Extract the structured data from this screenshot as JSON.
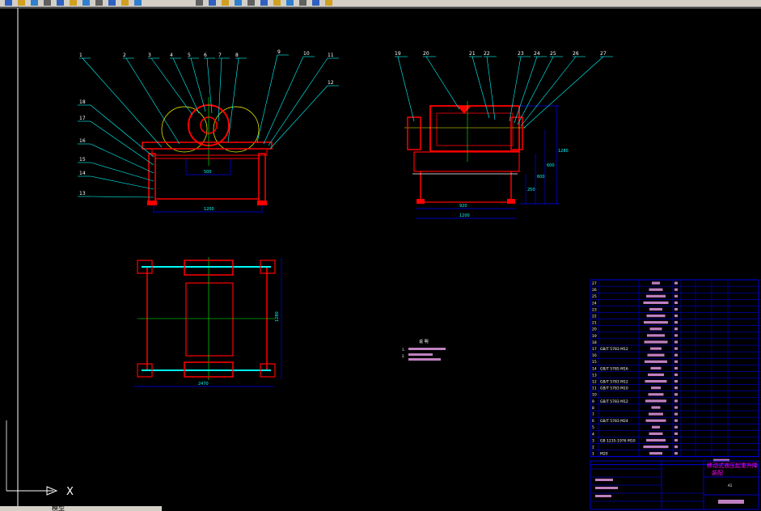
{
  "toolbar": {
    "icons": [
      "new-icon",
      "open-icon",
      "save-icon",
      "print-icon",
      "preview-icon",
      "cut-icon",
      "copy-icon",
      "paste-icon",
      "match-icon",
      "undo-icon",
      "redo-icon",
      "pan-icon",
      "zoom-realtime-icon",
      "zoom-window-icon",
      "zoom-previous-icon",
      "properties-icon",
      "designcenter-icon",
      "toolpalette-icon",
      "sheetset-icon",
      "markup-icon",
      "calc-icon",
      "help-icon"
    ],
    "colors": {
      "face": "#d4d0c8",
      "shadow": "#808080"
    }
  },
  "drawing": {
    "background": "#000000",
    "colors": {
      "outline": "#ff0000",
      "leader": "#00ffff",
      "dimension": "#0000ff",
      "center": "#ffff00",
      "axis": "#00ff00",
      "table": "#0000ff",
      "table_text": "#ff00ff"
    },
    "front_callouts": [
      "1",
      "2",
      "3",
      "4",
      "5",
      "6",
      "7",
      "8",
      "9",
      "10",
      "11",
      "12",
      "13",
      "14",
      "15",
      "16",
      "17",
      "18"
    ],
    "side_callouts": [
      "19",
      "20",
      "21",
      "22",
      "23",
      "24",
      "25",
      "26",
      "27"
    ],
    "front_dims": {
      "width": "1200",
      "inner": "500"
    },
    "side_dims": {
      "w1": "920",
      "w2": "1200",
      "h1": "250",
      "h2": "600",
      "h3": "600",
      "h4": "1280"
    },
    "plan_dims": {
      "width": "2470",
      "height": "1280"
    },
    "notes": {
      "title": "说 明",
      "line1": "1.",
      "line2": "2."
    }
  },
  "bom": {
    "rows": [
      "27",
      "26",
      "25",
      "24",
      "23",
      "22",
      "21",
      "20",
      "19",
      "18",
      "17",
      "16",
      "15",
      "14",
      "13",
      "12",
      "11",
      "10",
      "9",
      "8",
      "7",
      "6",
      "5",
      "4",
      "3",
      "2",
      "1"
    ],
    "standards": {
      "17": "GB/T 5783 M12",
      "14": "GB/T 5785 M16",
      "12": "GB/T 5783 M12",
      "11": "GB/T 5783 M10",
      "9": "GB/T 5783 M12",
      "6": "GB/T 5783 M24",
      "3": "GB 1235-1976 M10",
      "1": "M20"
    }
  },
  "title_block": {
    "title": "移动式液压起重升降",
    "sub": "装配",
    "scale": "A1"
  },
  "ucs": {
    "x_label": "X"
  },
  "status": {
    "tab": "模型"
  }
}
